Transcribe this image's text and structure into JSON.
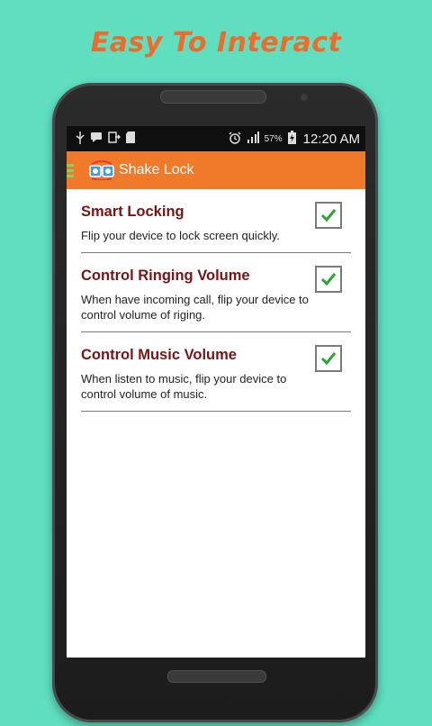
{
  "promo": {
    "headline": "Easy To Interact"
  },
  "status_bar": {
    "icons_left": [
      "usb-icon",
      "message-icon",
      "download-icon",
      "sdcard-icon"
    ],
    "icons_right": [
      "alarm-icon",
      "signal-icon",
      "battery-icon"
    ],
    "battery_percent": "57%",
    "time": "12:20 AM"
  },
  "action_bar": {
    "title": "Shake Lock",
    "icon": "shake-lock-app-icon"
  },
  "settings": [
    {
      "title": "Smart Locking",
      "description": "Flip your device to lock screen quickly.",
      "checked": true
    },
    {
      "title": "Control Ringing Volume",
      "description": "When have incoming call, flip your device to control volume of riging.",
      "checked": true
    },
    {
      "title": "Control Music Volume",
      "description": "When listen to music, flip your device to control volume of music.",
      "checked": true
    }
  ],
  "colors": {
    "background": "#5fdfc0",
    "promo_text": "#f26a2a",
    "action_bar": "#f07a2a",
    "setting_title": "#7a1414",
    "check_mark": "#2aa632"
  }
}
